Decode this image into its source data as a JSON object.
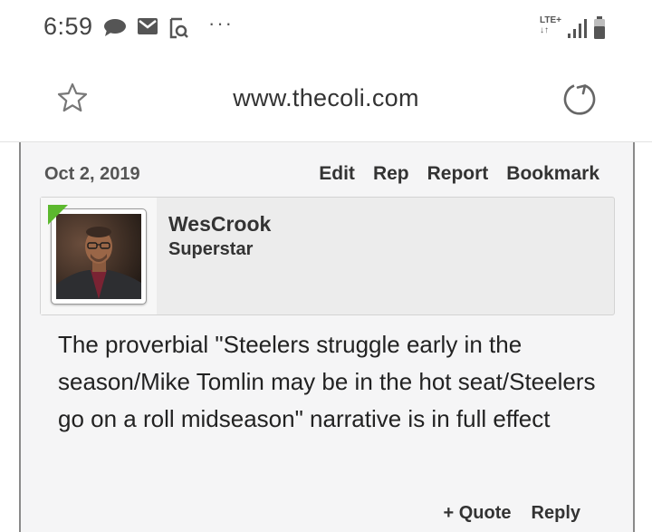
{
  "status_bar": {
    "time": "6:59",
    "icons": [
      "chat-bubble-icon",
      "gmail-icon",
      "screenshot-search-icon",
      "more-dots-icon"
    ],
    "more": "···",
    "network": "LTE+",
    "network_arrows": "↓↑",
    "signal_icon": "signal-bars-icon",
    "battery_icon": "battery-icon"
  },
  "browser": {
    "url": "www.thecoli.com",
    "bookmark_icon": "star-outline-icon",
    "reload_icon": "reload-icon"
  },
  "post": {
    "date": "Oct 2, 2019",
    "actions": [
      "Edit",
      "Rep",
      "Report",
      "Bookmark"
    ],
    "author": {
      "name": "WesCrook",
      "title": "Superstar",
      "online_indicator_color": "#5cb82e"
    },
    "body": "The proverbial \"Steelers struggle early in the season/Mike Tomlin may be in the hot seat/Steelers go on a roll midseason\" narrative is in full effect",
    "footer_actions": [
      "+ Quote",
      "Reply"
    ]
  }
}
